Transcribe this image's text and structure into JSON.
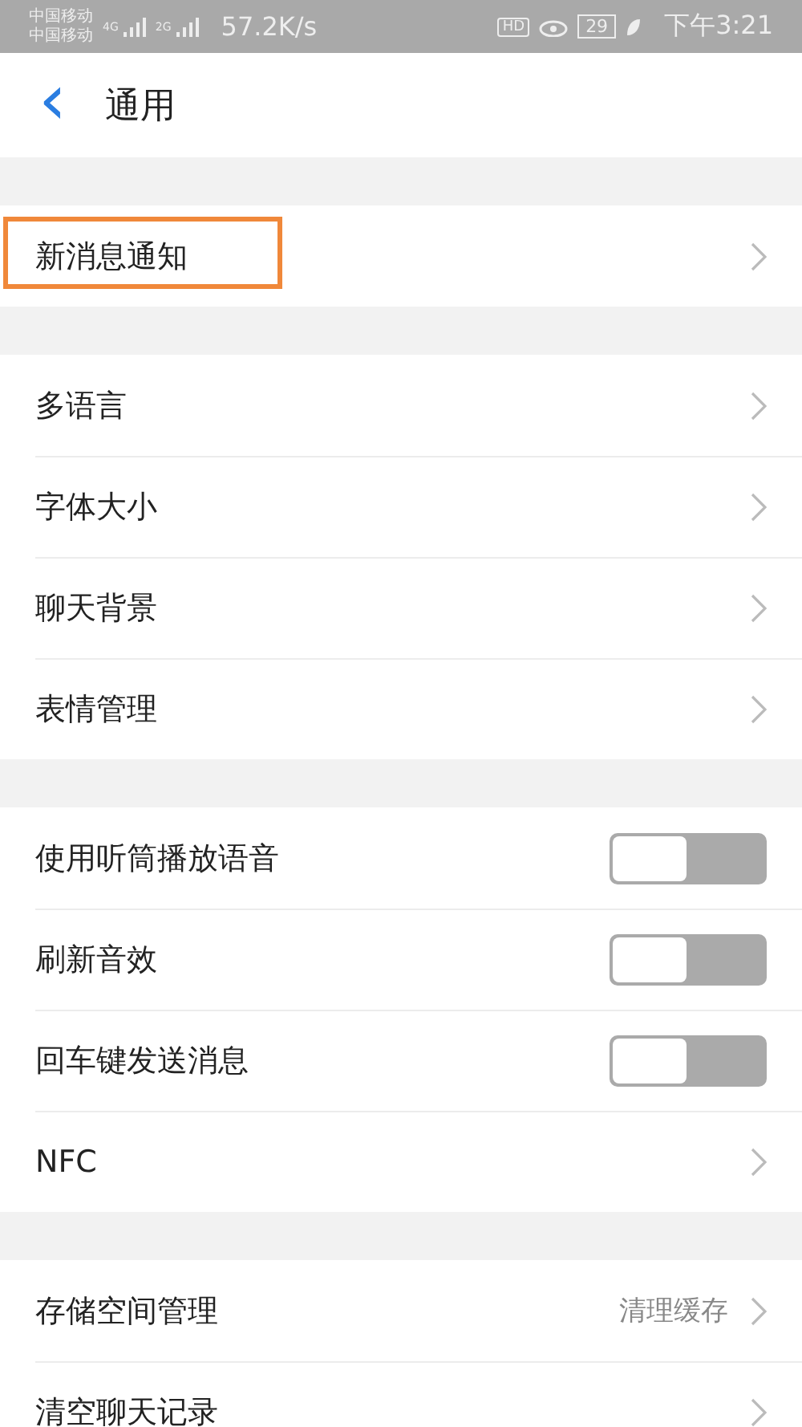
{
  "status_bar": {
    "carriers": [
      {
        "name": "中国移动",
        "network": "4G"
      },
      {
        "name": "中国移动",
        "network": "2G"
      }
    ],
    "speed": "57.2K/s",
    "hd": "HD",
    "battery": "29",
    "time": "下午3:21"
  },
  "header": {
    "back": "‹",
    "title": "通用"
  },
  "groups": [
    {
      "items": [
        {
          "kind": "link",
          "label": "新消息通知",
          "highlighted": true
        }
      ]
    },
    {
      "items": [
        {
          "kind": "link",
          "label": "多语言",
          "highlighted": false
        },
        {
          "kind": "link",
          "label": "字体大小",
          "highlighted": false
        },
        {
          "kind": "link",
          "label": "聊天背景",
          "highlighted": false
        },
        {
          "kind": "link",
          "label": "表情管理",
          "highlighted": false
        }
      ]
    },
    {
      "items": [
        {
          "kind": "toggle",
          "label": "使用听筒播放语音",
          "on": false
        },
        {
          "kind": "toggle",
          "label": "刷新音效",
          "on": false
        },
        {
          "kind": "toggle",
          "label": "回车键发送消息",
          "on": false
        },
        {
          "kind": "link",
          "label": "NFC",
          "highlighted": false
        }
      ]
    },
    {
      "items": [
        {
          "kind": "link",
          "label": "存储空间管理",
          "value": "清理缓存",
          "highlighted": false
        },
        {
          "kind": "link",
          "label": "清空聊天记录",
          "highlighted": false
        }
      ]
    }
  ]
}
